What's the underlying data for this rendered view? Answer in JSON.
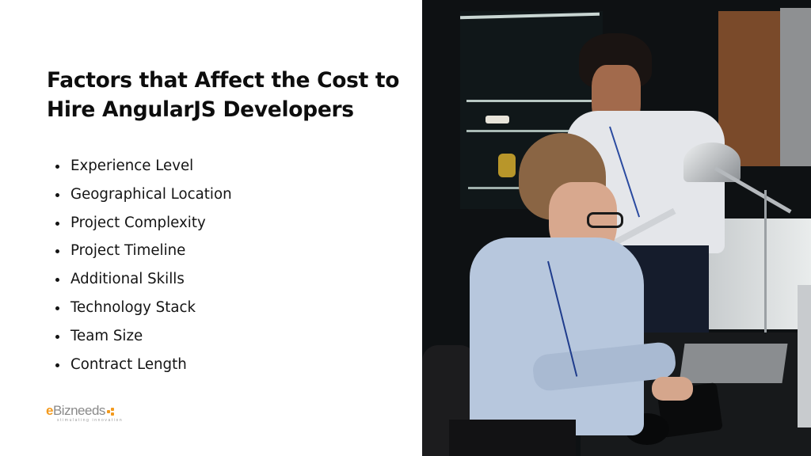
{
  "slide": {
    "title": "Factors that Affect the Cost to Hire AngularJS Developers",
    "factors": [
      "Experience Level",
      "Geographical Location",
      "Project Complexity",
      "Project Timeline",
      "Additional Skills",
      "Technology Stack",
      "Team Size",
      "Contract Length"
    ]
  },
  "logo": {
    "first_letter": "e",
    "rest": "Bizneeds",
    "tagline": "stimulating innovation",
    "accent_color": "#f39a1e"
  },
  "photo": {
    "description": "Two office workers: a woman in a light blue shirt typing at a keyboard, a man in a white shirt holding a tablet looking at her screen, desk lamp, dark shelves in background"
  }
}
